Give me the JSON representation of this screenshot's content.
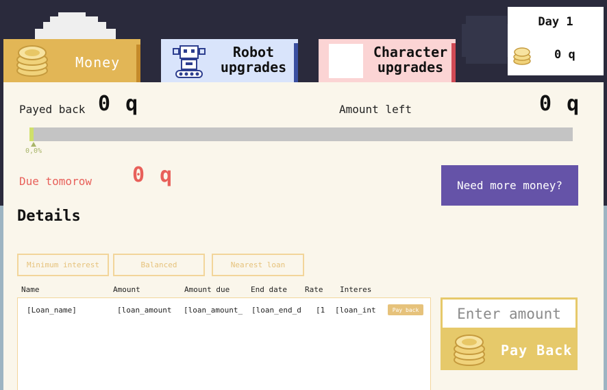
{
  "tabs": {
    "money": "Money",
    "robot": [
      "Robot",
      "upgrades"
    ],
    "character": [
      "Character",
      "upgrades"
    ]
  },
  "status": {
    "day": "Day 1",
    "balance": "0 q"
  },
  "loan": {
    "payed_back_label": "Payed back",
    "payed_back_value": "0 q",
    "amount_left_label": "Amount left",
    "amount_left_value": "0 q",
    "progress_text": "0,0%",
    "progress_fraction": 0.0,
    "due_label": "Due tomorow",
    "due_value": "0 q"
  },
  "need_money_label": "Need more money?",
  "details_title": "Details",
  "filters": [
    "Minimum interest",
    "Balanced",
    "Nearest loan"
  ],
  "table": {
    "headers": [
      "Name",
      "Amount",
      "Amount due",
      "End date",
      "Rate",
      "Interes"
    ],
    "rows": [
      {
        "name": "[Loan_name]",
        "amount": "[loan_amount",
        "amount_due": "[loan_amount_",
        "end_date": "[loan_end_d",
        "rate": "[1",
        "interest": "[loan_int",
        "button": "Pay back"
      }
    ]
  },
  "payback": {
    "placeholder": "Enter amount",
    "button_label": "Pay Back"
  },
  "colors": {
    "money_tab": "#e2b656",
    "robot_tab": "#d9e4fb",
    "character_tab": "#fbd4d4",
    "panel": "#faf6eb",
    "due": "#e8605a",
    "need_money_button": "#6553a8",
    "progress_fill": "#cfe06a"
  },
  "icons": [
    "coins-icon",
    "robot-icon"
  ]
}
